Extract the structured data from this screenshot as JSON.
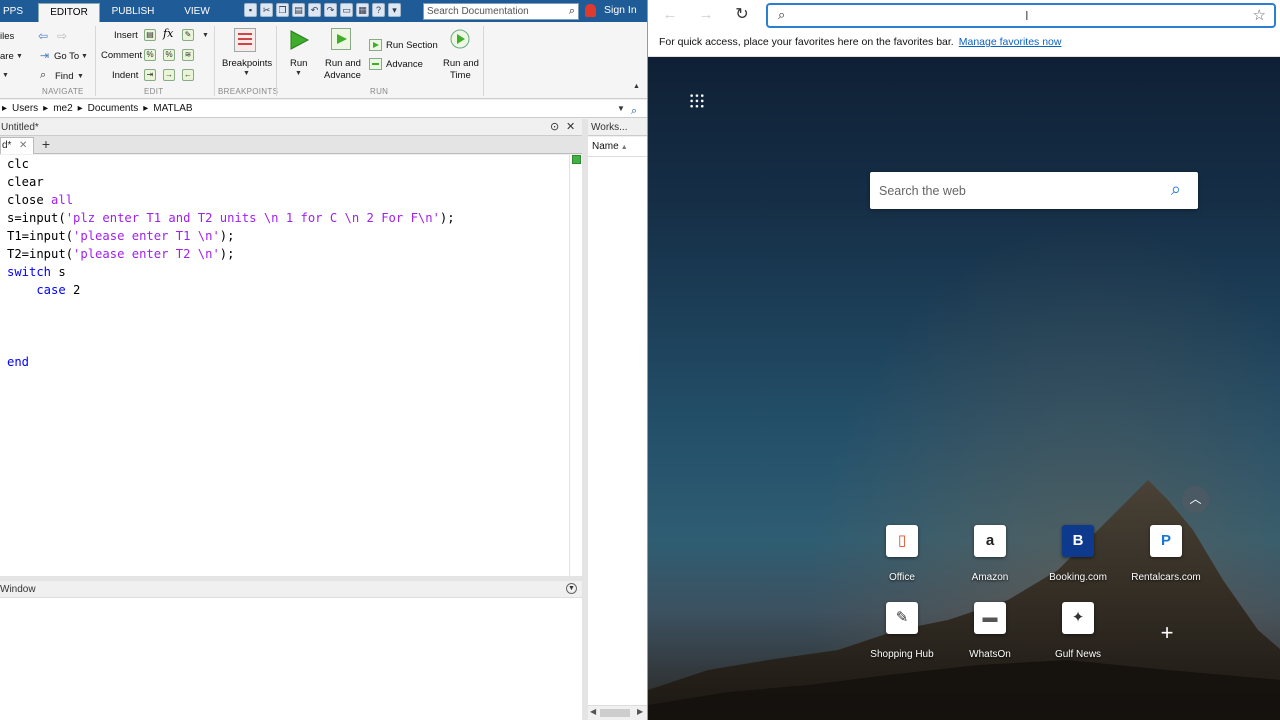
{
  "matlab": {
    "tabs": [
      {
        "label": "PPS",
        "active": false
      },
      {
        "label": "EDITOR",
        "active": true
      },
      {
        "label": "PUBLISH",
        "active": false
      },
      {
        "label": "VIEW",
        "active": false
      }
    ],
    "doc_search_placeholder": "Search Documentation",
    "sign_in": "Sign In",
    "ribbon": {
      "files_label": "iles",
      "save_label": "are",
      "goto_label": "Go To",
      "find_label": "Find",
      "insert_label": "Insert",
      "comment_label": "Comment",
      "indent_label": "Indent",
      "fx_label": "fx",
      "breakpoints_label": "Breakpoints",
      "run_label": "Run",
      "run_advance_label1": "Run and",
      "run_advance_label2": "Advance",
      "run_section_label": "Run Section",
      "advance_label": "Advance",
      "run_time_label1": "Run and",
      "run_time_label2": "Time",
      "sections": {
        "navigate": "NAVIGATE",
        "edit": "EDIT",
        "breakpoints": "BREAKPOINTS",
        "run": "RUN"
      }
    },
    "path": [
      "Users",
      "me2",
      "Documents",
      "MATLAB"
    ],
    "editor_title": "Untitled*",
    "editor_tab": "d*",
    "code": {
      "l1": "clc",
      "l2": "clear",
      "l3a": "close ",
      "l3b": "all",
      "l4a": "s=input(",
      "l4b": "'plz enter T1 and T2 units \\n 1 for C \\n 2 For F\\n'",
      "l4c": ");",
      "l5a": "T1=input(",
      "l5b": "'please enter T1 \\n'",
      "l5c": ");",
      "l6a": "T2=input(",
      "l6b": "'please enter T2 \\n'",
      "l6c": ");",
      "l7a": "switch",
      "l7b": " s",
      "l8a": "    case",
      "l8b": " 2",
      "l12": "end"
    },
    "command_window_title": "Window",
    "workspace_title": "Works...",
    "workspace_col": "Name"
  },
  "edge": {
    "address_value": "",
    "fav_message": "For quick access, place your favorites here on the favorites bar.",
    "fav_link": "Manage favorites now",
    "search_placeholder": "Search the web",
    "tiles": [
      {
        "label": "Office",
        "icon": "office-icon",
        "glyph": "▯",
        "color": "#e34c26"
      },
      {
        "label": "Amazon",
        "icon": "amazon-icon",
        "glyph": "a",
        "color": "#222"
      },
      {
        "label": "Booking.com",
        "icon": "booking-icon",
        "glyph": "B",
        "color": "#0d3a8c"
      },
      {
        "label": "Rentalcars.com",
        "icon": "rentalcars-icon",
        "glyph": "P",
        "color": "#1577d6"
      },
      {
        "label": "Shopping Hub",
        "icon": "shopping-hub-icon",
        "glyph": "✎",
        "color": "#333"
      },
      {
        "label": "WhatsOn",
        "icon": "whatson-icon",
        "glyph": "▬",
        "color": "#555"
      },
      {
        "label": "Gulf News",
        "icon": "gulf-news-icon",
        "glyph": "✦",
        "color": "#333"
      }
    ]
  }
}
